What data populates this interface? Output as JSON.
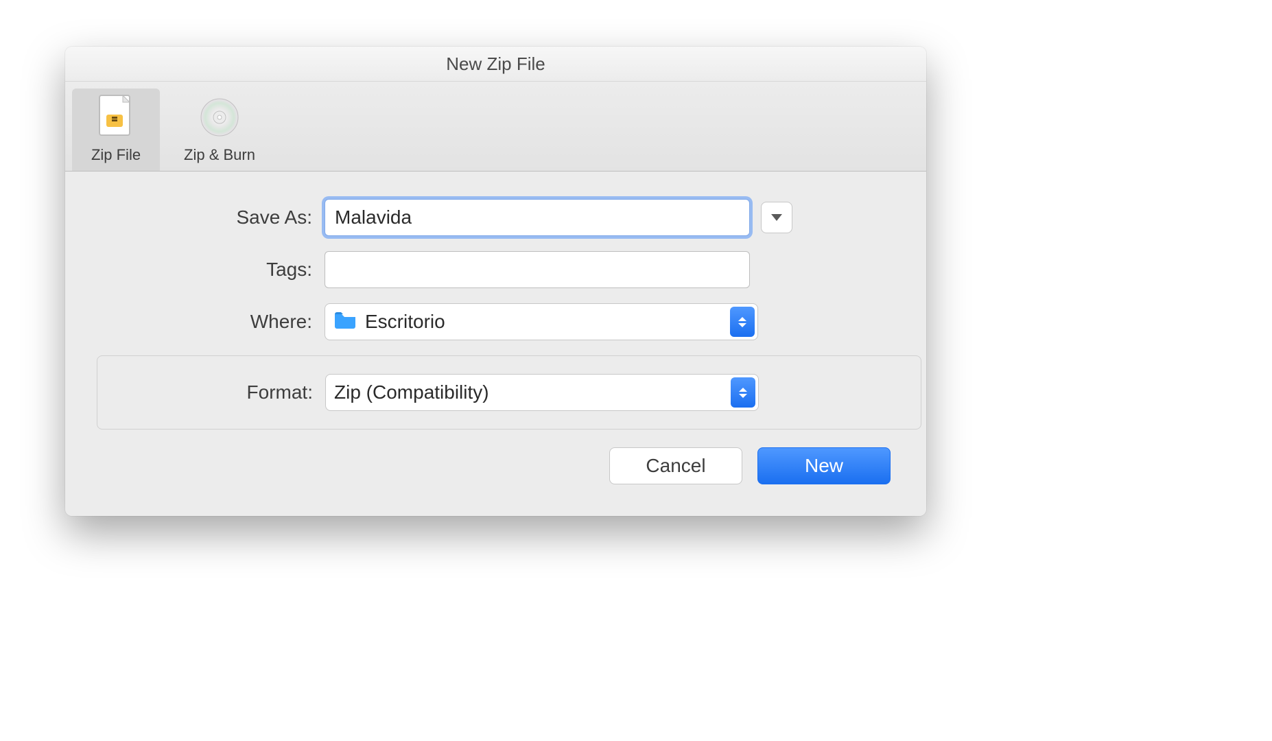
{
  "dialog": {
    "title": "New Zip File",
    "toolbar": {
      "items": [
        {
          "label": "Zip File",
          "icon": "zip-file-icon",
          "selected": true
        },
        {
          "label": "Zip & Burn",
          "icon": "disc-icon",
          "selected": false
        }
      ]
    },
    "fields": {
      "save_as": {
        "label": "Save As:",
        "value": "Malavida"
      },
      "tags": {
        "label": "Tags:",
        "value": ""
      },
      "where": {
        "label": "Where:",
        "value": "Escritorio",
        "icon": "folder-icon"
      },
      "format": {
        "label": "Format:",
        "value": "Zip (Compatibility)"
      }
    },
    "buttons": {
      "cancel": "Cancel",
      "confirm": "New"
    }
  },
  "colors": {
    "accent": "#1b6ff0",
    "folder": "#3aa3ff"
  }
}
